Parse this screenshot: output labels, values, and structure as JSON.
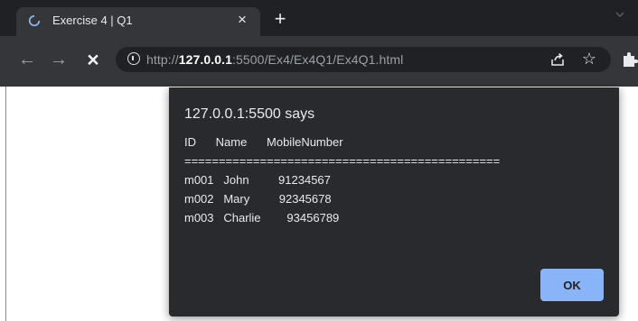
{
  "browser": {
    "tab": {
      "title": "Exercise 4 | Q1",
      "close_icon": "×",
      "loading_icon": "loading-spinner"
    },
    "new_tab_icon": "+",
    "nav": {
      "back_icon": "←",
      "forward_icon": "→",
      "stop_icon": "×"
    },
    "address": {
      "scheme": "http://",
      "host": "127.0.0.1",
      "rest": ":5500/Ex4/Ex4Q1/Ex4Q1.html"
    },
    "star_icon": "☆"
  },
  "dialog": {
    "title": "127.0.0.1:5500 says",
    "message": "ID      Name      MobileNumber\n==============================================\nm001   John         91234567\nm002   Mary         92345678\nm003   Charlie        93456789",
    "ok_label": "OK"
  },
  "colors": {
    "tabstrip": "#202124",
    "toolbar": "#35363a",
    "dialog_bg": "#292a2d",
    "ok_button": "#8ab4f8"
  }
}
